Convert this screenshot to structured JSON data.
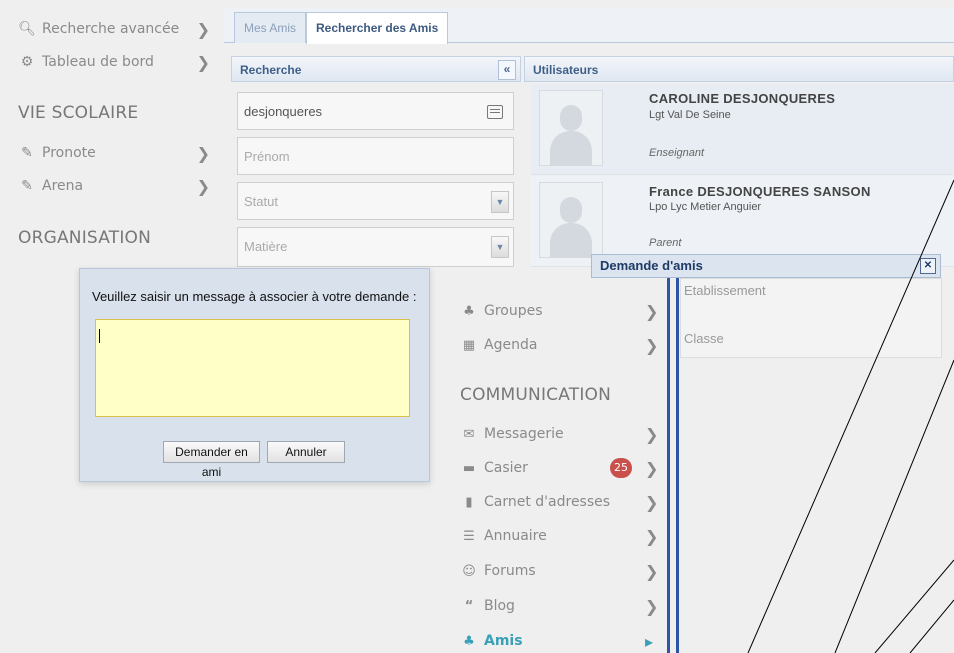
{
  "sidebar": {
    "top_items": [
      {
        "label": "Recherche avancée",
        "icon": "search-icon"
      },
      {
        "label": "Tableau de bord",
        "icon": "dashboard-icon"
      }
    ],
    "vie_scolaire": {
      "title": "VIE SCOLAIRE",
      "items": [
        {
          "label": "Pronote",
          "icon": "edit-icon"
        },
        {
          "label": "Arena",
          "icon": "edit-icon"
        }
      ]
    },
    "organisation": {
      "title": "ORGANISATION"
    }
  },
  "tabs": [
    {
      "label": "Mes Amis",
      "active": false
    },
    {
      "label": "Rechercher des Amis",
      "active": true
    }
  ],
  "search_panel": {
    "title": "Recherche",
    "collapse_symbol": "«",
    "name_value": "desjonqueres",
    "prenom_placeholder": "Prénom",
    "statut_placeholder": "Statut",
    "matiere_placeholder": "Matière"
  },
  "users_panel": {
    "title": "Utilisateurs",
    "users": [
      {
        "name": "CAROLINE DESJONQUERES",
        "school": "Lgt Val De Seine",
        "role": "Enseignant"
      },
      {
        "name": "France DESJONQUERES SANSON",
        "school": "Lpo Lyc Metier Anguier",
        "role": "Parent"
      }
    ]
  },
  "dialog": {
    "message": "Veuillez saisir un message à associer à votre demande :",
    "request_button": "Demander en ami",
    "cancel_button": "Annuler"
  },
  "friend_request_window": {
    "title": "Demande d'amis",
    "etablissement_placeholder": "Etablissement",
    "classe_placeholder": "Classe"
  },
  "communication_menu": {
    "upper_items": [
      {
        "label": "Groupes",
        "icon": "groups-icon"
      },
      {
        "label": "Agenda",
        "icon": "calendar-icon"
      }
    ],
    "title": "COMMUNICATION",
    "items": [
      {
        "label": "Messagerie",
        "icon": "mail-icon"
      },
      {
        "label": "Casier",
        "icon": "locker-icon",
        "badge": "25"
      },
      {
        "label": "Carnet d'adresses",
        "icon": "address-book-icon"
      },
      {
        "label": "Annuaire",
        "icon": "directory-icon"
      },
      {
        "label": "Forums",
        "icon": "forum-icon"
      },
      {
        "label": "Blog",
        "icon": "quote-icon"
      },
      {
        "label": "Amis",
        "icon": "friends-icon",
        "active": true
      }
    ]
  },
  "colors": {
    "accent": "#3d5a80",
    "badge": "#c9504b",
    "active_menu": "#3aa0b8",
    "textarea_bg": "#ffffc8"
  }
}
